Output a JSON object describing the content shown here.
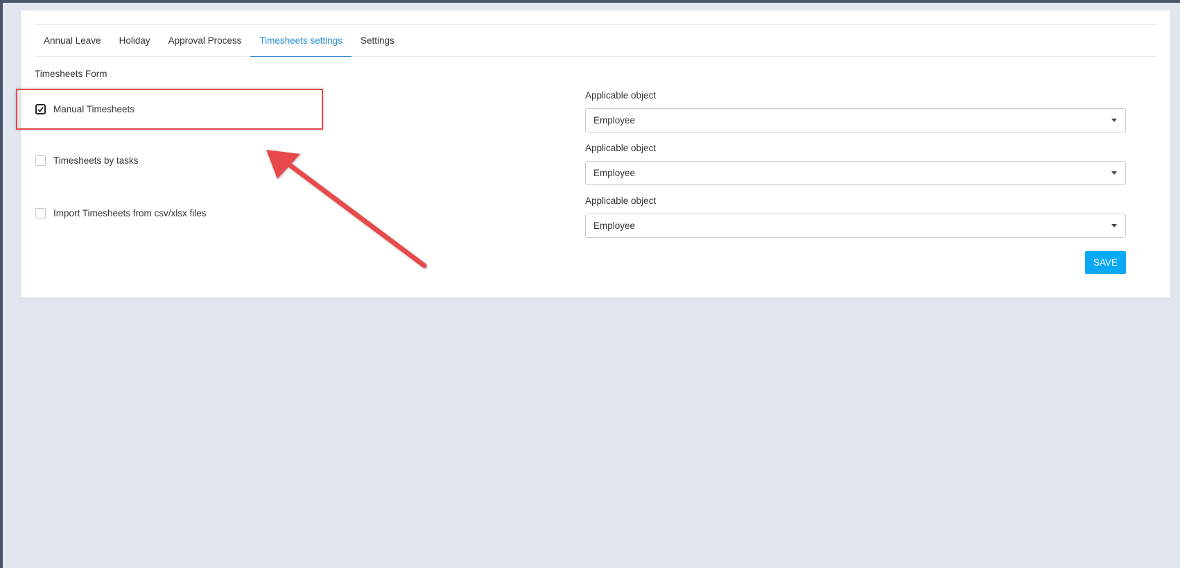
{
  "tabs": [
    {
      "label": "Annual Leave"
    },
    {
      "label": "Holiday"
    },
    {
      "label": "Approval Process"
    },
    {
      "label": "Timesheets settings",
      "active": true
    },
    {
      "label": "Settings"
    }
  ],
  "form": {
    "title": "Timesheets Form",
    "options": [
      {
        "label": "Manual Timesheets",
        "checked": true,
        "applicable_label": "Applicable object",
        "applicable_value": "Employee"
      },
      {
        "label": "Timesheets by tasks",
        "checked": false,
        "applicable_label": "Applicable object",
        "applicable_value": "Employee"
      },
      {
        "label": "Import Timesheets from csv/xlsx files",
        "checked": false,
        "applicable_label": "Applicable object",
        "applicable_value": "Employee"
      }
    ],
    "save_label": "SAVE"
  },
  "annotation": {
    "highlight_color": "#e5484d",
    "arrow_color": "#e84a4a"
  },
  "colors": {
    "accent": "#2a8dd4",
    "button": "#0aa8f5",
    "background": "#e2e7ef"
  }
}
